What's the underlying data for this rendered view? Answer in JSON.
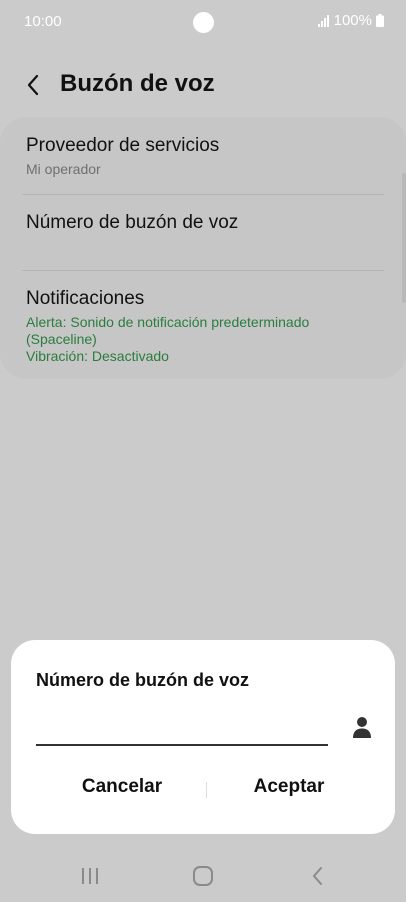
{
  "status": {
    "time": "10:00",
    "battery": "100%"
  },
  "header": {
    "title": "Buzón de voz"
  },
  "settings": [
    {
      "title": "Proveedor de servicios",
      "subtitle": "Mi operador"
    },
    {
      "title": "Número de buzón de voz"
    },
    {
      "title": "Notificaciones",
      "line1": "Alerta: Sonido de notificación predeterminado",
      "line2": "(Spaceline)",
      "line3": "Vibración: Desactivado"
    }
  ],
  "dialog": {
    "title": "Número de buzón de voz",
    "input_value": "",
    "cancel": "Cancelar",
    "accept": "Aceptar"
  },
  "colors": {
    "accent_green": "#2a7d3e",
    "background": "#cbcbcb",
    "dialog": "#ffffff"
  },
  "icons": [
    "signal-icon",
    "battery-icon",
    "back-arrow-icon",
    "contact-icon",
    "recent-apps-icon",
    "home-icon",
    "back-nav-icon"
  ]
}
